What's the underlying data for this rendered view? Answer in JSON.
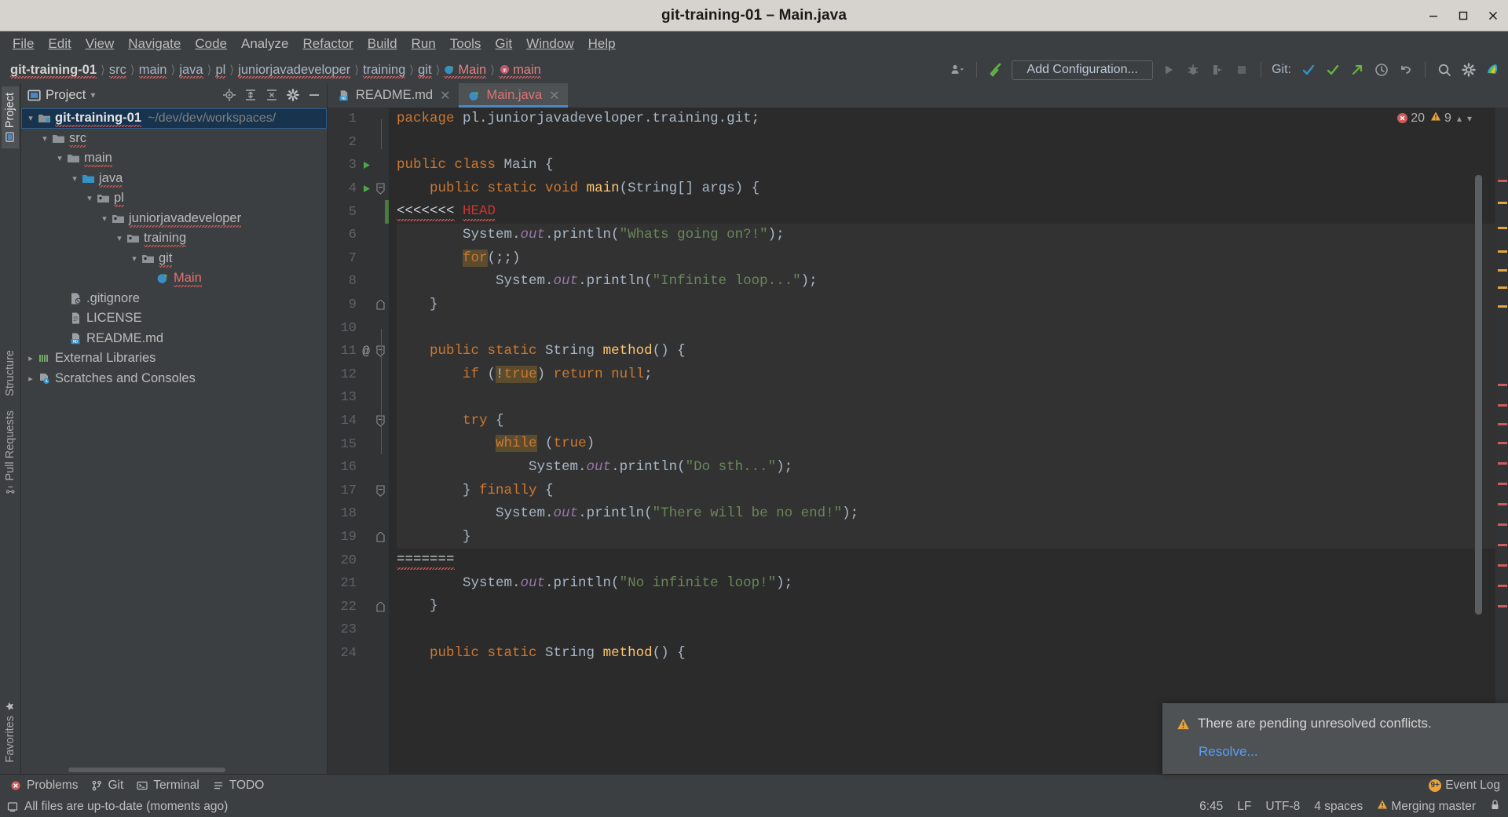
{
  "window": {
    "title": "git-training-01 – Main.java",
    "controls": [
      "minimize",
      "maximize",
      "close"
    ]
  },
  "menubar": {
    "items": [
      "File",
      "Edit",
      "View",
      "Navigate",
      "Code",
      "Analyze",
      "Refactor",
      "Build",
      "Run",
      "Tools",
      "Git",
      "Window",
      "Help"
    ]
  },
  "navbar": {
    "breadcrumbs": [
      {
        "label": "git-training-01",
        "style": "bold"
      },
      {
        "label": "src",
        "style": "plain"
      },
      {
        "label": "main",
        "style": "plain"
      },
      {
        "label": "java",
        "style": "plain"
      },
      {
        "label": "pl",
        "style": "plain"
      },
      {
        "label": "juniorjavadeveloper",
        "style": "plain"
      },
      {
        "label": "training",
        "style": "plain"
      },
      {
        "label": "git",
        "style": "plain"
      },
      {
        "label": "Main",
        "style": "red",
        "icon": "java-class-icon"
      },
      {
        "label": "main",
        "style": "red",
        "icon": "method-icon"
      }
    ],
    "add_configuration_label": "Add Configuration...",
    "git_label": "Git:",
    "icons": [
      "user-dropdown-icon",
      "hammer-build-icon",
      "run-icon",
      "debug-icon",
      "run-coverage-icon",
      "stop-icon",
      "git-update-icon",
      "git-commit-icon",
      "git-push-icon",
      "git-history-icon",
      "git-rollback-icon",
      "search-everywhere-icon",
      "settings-gear-icon",
      "ide-logo-icon"
    ]
  },
  "rail": {
    "left_top": [
      {
        "label": "Project",
        "active": true,
        "icon": "project-icon"
      }
    ],
    "left_middle": [
      {
        "label": "Structure",
        "active": false,
        "icon": "structure-icon"
      },
      {
        "label": "Pull Requests",
        "active": false,
        "icon": "pull-request-icon"
      }
    ],
    "left_bottom": [
      {
        "label": "Favorites",
        "active": false,
        "icon": "star-icon"
      }
    ]
  },
  "project_panel": {
    "title": "Project",
    "header_icons": [
      "locate-target-icon",
      "expand-all-icon",
      "collapse-all-icon",
      "settings-gear-icon",
      "hide-icon"
    ],
    "tree": [
      {
        "label": "git-training-01",
        "path": "~/dev/dev/workspaces/",
        "depth": 0,
        "arrow": "down",
        "icon": "module-icon",
        "style": "bold",
        "selected": true,
        "squiggle": true
      },
      {
        "label": "src",
        "depth": 1,
        "arrow": "down",
        "icon": "folder-icon",
        "style": "plain",
        "squiggle": true
      },
      {
        "label": "main",
        "depth": 2,
        "arrow": "down",
        "icon": "folder-icon",
        "style": "plain",
        "squiggle": true
      },
      {
        "label": "java",
        "depth": 3,
        "arrow": "down",
        "icon": "source-folder-icon",
        "style": "plain",
        "squiggle": true
      },
      {
        "label": "pl",
        "depth": 4,
        "arrow": "down",
        "icon": "package-icon",
        "style": "plain",
        "squiggle": true
      },
      {
        "label": "juniorjavadeveloper",
        "depth": 5,
        "arrow": "down",
        "icon": "package-icon",
        "style": "plain",
        "squiggle": true
      },
      {
        "label": "training",
        "depth": 6,
        "arrow": "down",
        "icon": "package-icon",
        "style": "plain",
        "squiggle": true
      },
      {
        "label": "git",
        "depth": 7,
        "arrow": "down",
        "icon": "package-icon",
        "style": "plain",
        "squiggle": true
      },
      {
        "label": "Main",
        "depth": 8,
        "arrow": "none",
        "icon": "java-class-icon",
        "style": "red",
        "squiggle": true
      },
      {
        "label": ".gitignore",
        "depth": 1,
        "arrow": "none",
        "icon": "gitignore-icon",
        "style": "plain"
      },
      {
        "label": "LICENSE",
        "depth": 1,
        "arrow": "none",
        "icon": "file-icon",
        "style": "plain"
      },
      {
        "label": "README.md",
        "depth": 1,
        "arrow": "none",
        "icon": "markdown-icon",
        "style": "plain"
      },
      {
        "label": "External Libraries",
        "depth": 0,
        "arrow": "right",
        "icon": "libraries-icon",
        "style": "plain"
      },
      {
        "label": "Scratches and Consoles",
        "depth": 0,
        "arrow": "right",
        "icon": "scratches-icon",
        "style": "plain"
      }
    ]
  },
  "editor": {
    "tabs": [
      {
        "label": "README.md",
        "icon": "markdown-icon",
        "active": false,
        "closable": true
      },
      {
        "label": "Main.java",
        "icon": "java-class-icon",
        "active": true,
        "closable": true
      }
    ],
    "inspections": {
      "error_count": "20",
      "warning_count": "9"
    },
    "lines": [
      {
        "n": "1",
        "runnable": false,
        "fold": "none",
        "at": false,
        "change": false,
        "highlight": false
      },
      {
        "n": "2",
        "runnable": false,
        "fold": "none",
        "at": false,
        "change": false,
        "highlight": false
      },
      {
        "n": "3",
        "runnable": true,
        "fold": "none",
        "at": false,
        "change": false,
        "highlight": false
      },
      {
        "n": "4",
        "runnable": true,
        "fold": "start",
        "at": false,
        "change": false,
        "highlight": false
      },
      {
        "n": "5",
        "runnable": false,
        "fold": "none",
        "at": false,
        "change": true,
        "highlight": false
      },
      {
        "n": "6",
        "runnable": false,
        "fold": "none",
        "at": false,
        "change": false,
        "highlight": true
      },
      {
        "n": "7",
        "runnable": false,
        "fold": "none",
        "at": false,
        "change": false,
        "highlight": true
      },
      {
        "n": "8",
        "runnable": false,
        "fold": "none",
        "at": false,
        "change": false,
        "highlight": true
      },
      {
        "n": "9",
        "runnable": false,
        "fold": "end",
        "at": false,
        "change": false,
        "highlight": true
      },
      {
        "n": "10",
        "runnable": false,
        "fold": "none",
        "at": false,
        "change": false,
        "highlight": true
      },
      {
        "n": "11",
        "runnable": false,
        "fold": "start",
        "at": true,
        "change": false,
        "highlight": true
      },
      {
        "n": "12",
        "runnable": false,
        "fold": "none",
        "at": false,
        "change": false,
        "highlight": true
      },
      {
        "n": "13",
        "runnable": false,
        "fold": "none",
        "at": false,
        "change": false,
        "highlight": true
      },
      {
        "n": "14",
        "runnable": false,
        "fold": "start",
        "at": false,
        "change": false,
        "highlight": true
      },
      {
        "n": "15",
        "runnable": false,
        "fold": "none",
        "at": false,
        "change": false,
        "highlight": true
      },
      {
        "n": "16",
        "runnable": false,
        "fold": "none",
        "at": false,
        "change": false,
        "highlight": true
      },
      {
        "n": "17",
        "runnable": false,
        "fold": "start",
        "at": false,
        "change": false,
        "highlight": true
      },
      {
        "n": "18",
        "runnable": false,
        "fold": "none",
        "at": false,
        "change": false,
        "highlight": true
      },
      {
        "n": "19",
        "runnable": false,
        "fold": "end",
        "at": false,
        "change": false,
        "highlight": true
      },
      {
        "n": "20",
        "runnable": false,
        "fold": "none",
        "at": false,
        "change": false,
        "highlight": false
      },
      {
        "n": "21",
        "runnable": false,
        "fold": "none",
        "at": false,
        "change": false,
        "highlight": false
      },
      {
        "n": "22",
        "runnable": false,
        "fold": "end",
        "at": false,
        "change": false,
        "highlight": false
      },
      {
        "n": "23",
        "runnable": false,
        "fold": "none",
        "at": false,
        "change": false,
        "highlight": false
      },
      {
        "n": "24",
        "runnable": false,
        "fold": "none",
        "at": false,
        "change": false,
        "highlight": false
      }
    ],
    "source_text": [
      "package pl.juniorjavadeveloper.training.git;",
      "",
      "public class Main {",
      "    public static void main(String[] args) {",
      "<<<<<<< HEAD",
      "        System.out.println(\"Whats going on?!\");",
      "        for(;;)",
      "            System.out.println(\"Infinite loop...\");",
      "    }",
      "",
      "    public static String method() {",
      "        if (!true) return null;",
      "",
      "        try {",
      "            while (true)",
      "                System.out.println(\"Do sth...\");",
      "        } finally {",
      "            System.out.println(\"There will be no end!\");",
      "        }",
      "=======",
      "        System.out.println(\"No infinite loop!\");",
      "    }",
      "",
      "    public static String method() {"
    ]
  },
  "notification": {
    "icon": "warning-icon",
    "message": "There are pending unresolved conflicts.",
    "action_label": "Resolve..."
  },
  "bottom_toolbar": {
    "buttons": [
      {
        "label": "Problems",
        "icon": "problems-icon"
      },
      {
        "label": "Git",
        "icon": "git-branch-icon"
      },
      {
        "label": "Terminal",
        "icon": "terminal-icon"
      },
      {
        "label": "TODO",
        "icon": "todo-icon"
      }
    ],
    "event_log": {
      "label": "Event Log",
      "badge": "9+"
    }
  },
  "statusbar": {
    "message": "All files are up-to-date (moments ago)",
    "message_icon": "sync-icon",
    "caret_position": "6:45",
    "line_separator": "LF",
    "encoding": "UTF-8",
    "indent": "4 spaces",
    "branch": "Merging master",
    "branch_icon": "warning-icon",
    "lock_icon": "lock-icon"
  },
  "colors": {
    "accent_blue": "#4a88c7",
    "warning_orange": "#e8a33d",
    "error_red": "#cc3333",
    "conflict_red": "#e0716f",
    "keyword_orange": "#cc7832",
    "string_green": "#6a8759",
    "editor_bg": "#2b2b2b",
    "panel_bg": "#3c3f41",
    "selection_blue": "#17334d"
  }
}
